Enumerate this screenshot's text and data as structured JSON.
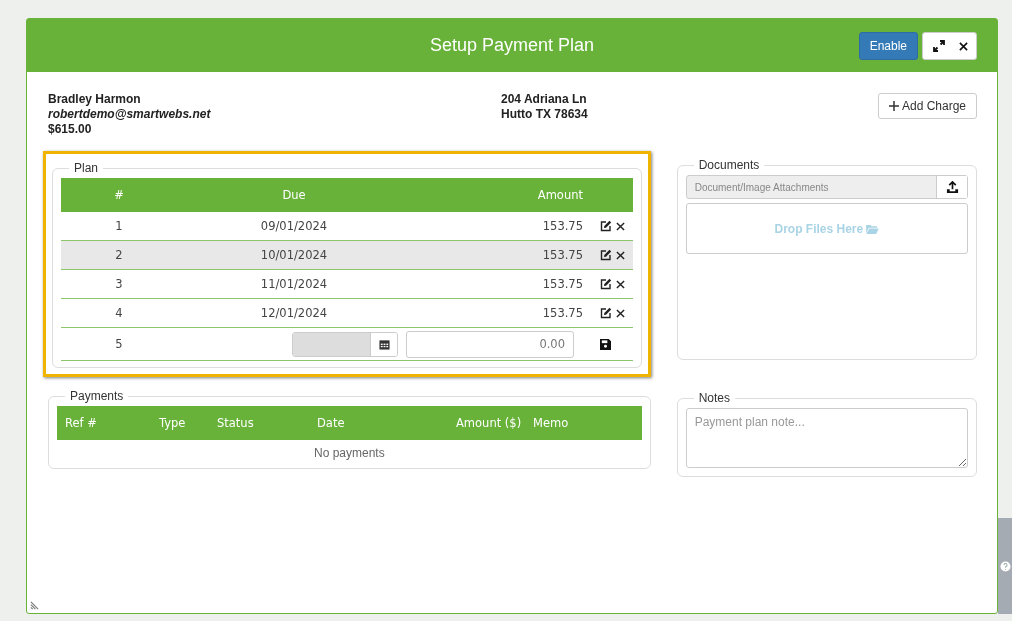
{
  "modal": {
    "title": "Setup Payment Plan",
    "enable_button": "Enable"
  },
  "customer": {
    "name": "Bradley Harmon",
    "email": "robertdemo@smartwebs.net",
    "balance": "$615.00",
    "address_line_1": "204 Adriana Ln",
    "address_line_2": "Hutto TX 78634"
  },
  "add_charge_button": "Add Charge",
  "plan": {
    "legend": "Plan",
    "highlighted": true,
    "columns": [
      "#",
      "Due",
      "Amount"
    ],
    "rows": [
      {
        "number": "1",
        "due": "09/01/2024",
        "amount": "153.75",
        "selected": false
      },
      {
        "number": "2",
        "due": "10/01/2024",
        "amount": "153.75",
        "selected": true
      },
      {
        "number": "3",
        "due": "11/01/2024",
        "amount": "153.75",
        "selected": false
      },
      {
        "number": "4",
        "due": "12/01/2024",
        "amount": "153.75",
        "selected": false
      }
    ],
    "new_row": {
      "number": "5",
      "amount_placeholder": "0.00"
    }
  },
  "documents": {
    "legend": "Documents",
    "attachments_placeholder": "Document/Image Attachments",
    "drop_zone": "Drop Files Here"
  },
  "payments": {
    "legend": "Payments",
    "columns": [
      "Ref #",
      "Type",
      "Status",
      "Date",
      "Amount ($)",
      "Memo"
    ],
    "empty_message": "No payments"
  },
  "notes": {
    "legend": "Notes",
    "placeholder": "Payment plan note..."
  }
}
